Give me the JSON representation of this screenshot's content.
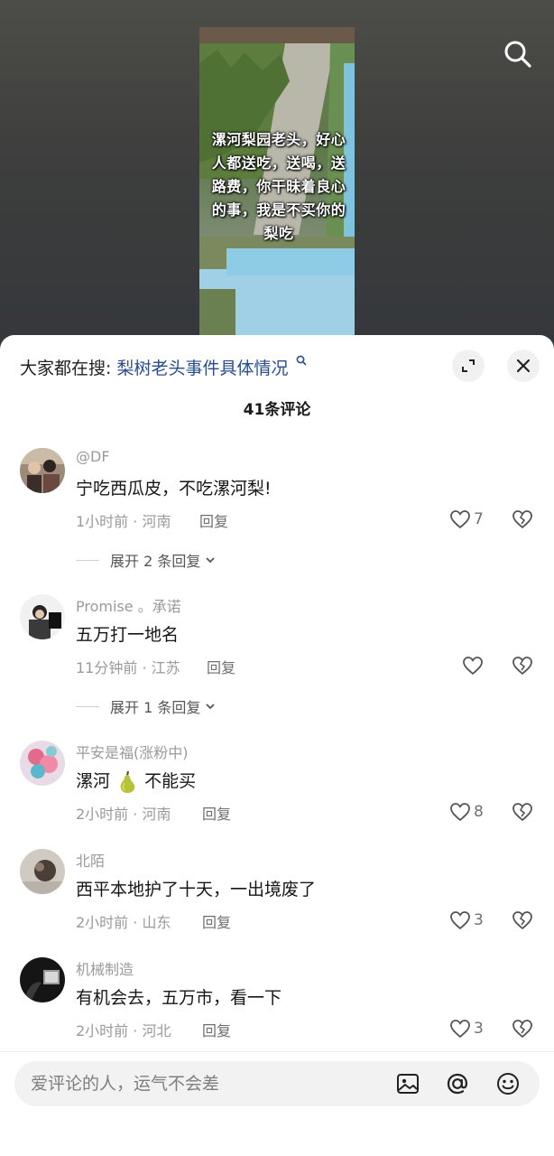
{
  "video": {
    "caption": "漯河梨园老头，好心人都送吃，送喝，送路费，你干昧着良心的事，我是不买你的梨吃"
  },
  "sheet": {
    "trending_prefix": "大家都在搜:",
    "trending_query": "梨树老头事件具体情况",
    "comment_count": "41条评论"
  },
  "comments": [
    {
      "user": "@DF",
      "text": "宁吃西瓜皮，不吃漯河梨!",
      "meta": "1小时前 · 河南",
      "reply_label": "回复",
      "likes": "7",
      "expand": "展开 2 条回复"
    },
    {
      "user": "Promise 。承诺",
      "text": "五万打一地名",
      "meta": "11分钟前 · 江苏",
      "reply_label": "回复",
      "likes": "",
      "expand": "展开 1 条回复"
    },
    {
      "user": "平安是福(涨粉中)",
      "text_before": "漯河",
      "text_after": "不能买",
      "meta": "2小时前 · 河南",
      "reply_label": "回复",
      "likes": "8"
    },
    {
      "user": "北陌",
      "text": "西平本地护了十天，一出境废了",
      "meta": "2小时前 · 山东",
      "reply_label": "回复",
      "likes": "3"
    },
    {
      "user": "机械制造",
      "text": "有机会去，五万市，看一下",
      "meta": "2小时前 · 河北",
      "reply_label": "回复",
      "likes": "3"
    }
  ],
  "input": {
    "placeholder": "爱评论的人，运气不会差"
  },
  "icons": {
    "search": "search-icon",
    "expand": "expand-icon",
    "close": "close-icon",
    "like": "heart-icon",
    "dislike": "broken-heart-icon",
    "image": "image-icon",
    "mention": "at-icon",
    "emoji": "emoji-icon"
  },
  "colors": {
    "link": "#2a4e8c",
    "muted_text": "#9a9a9a"
  }
}
